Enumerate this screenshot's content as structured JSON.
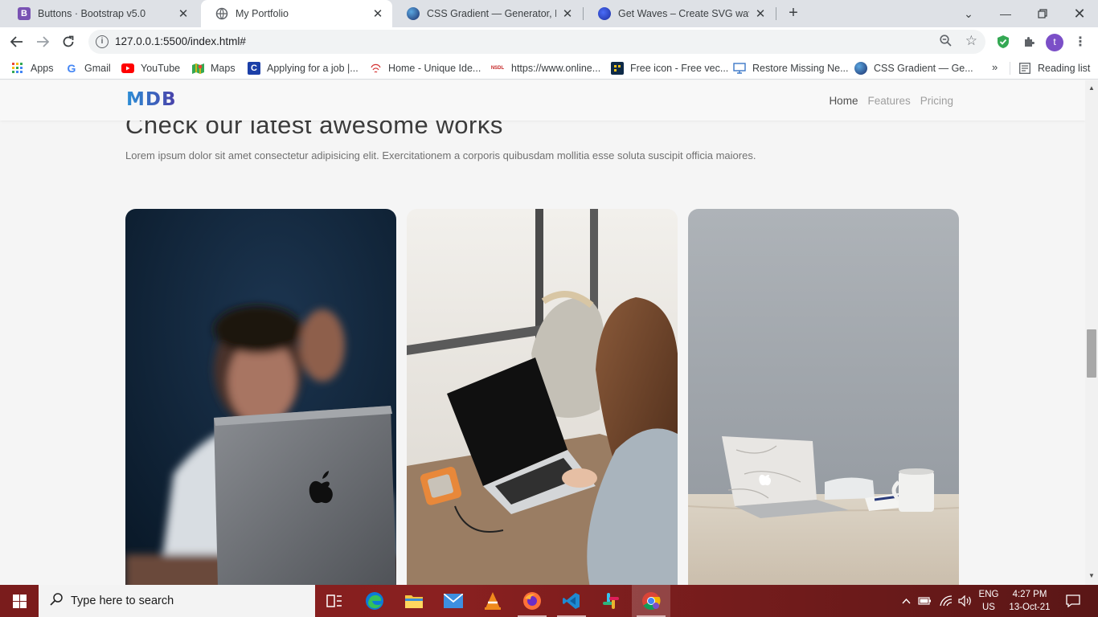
{
  "browser": {
    "tabs": [
      {
        "title": "Buttons · Bootstrap v5.0",
        "active": false
      },
      {
        "title": "My Portfolio",
        "active": true
      },
      {
        "title": "CSS Gradient — Generator, Maker",
        "active": false
      },
      {
        "title": "Get Waves – Create SVG waves for",
        "active": false
      }
    ],
    "url": "127.0.0.1:5500/index.html#",
    "profile_initial": "t",
    "bookmarks": [
      {
        "label": "Apps",
        "icon": "apps-grid-icon"
      },
      {
        "label": "Gmail",
        "icon": "google-icon"
      },
      {
        "label": "YouTube",
        "icon": "youtube-icon"
      },
      {
        "label": "Maps",
        "icon": "maps-icon"
      },
      {
        "label": "Applying for a job |...",
        "icon": "c-icon"
      },
      {
        "label": "Home - Unique Ide...",
        "icon": "fingerprint-icon"
      },
      {
        "label": "https://www.online...",
        "icon": "nsdl-icon"
      },
      {
        "label": "Free icon - Free vec...",
        "icon": "freepik-icon"
      },
      {
        "label": "Restore Missing Ne...",
        "icon": "monitor-icon"
      },
      {
        "label": "CSS Gradient — Ge...",
        "icon": "css-gradient-icon"
      }
    ],
    "bookmarks_overflow": "»",
    "reading_list": "Reading list"
  },
  "site": {
    "logo": "MDB",
    "nav": [
      {
        "label": "Home",
        "current": true
      },
      {
        "label": "Features",
        "current": false
      },
      {
        "label": "Pricing",
        "current": false
      }
    ],
    "heading": "Check our latest awesome works",
    "lead": "Lorem ipsum dolor sit amet consectetur adipisicing elit. Exercitationem a corporis quibusdam mollitia esse soluta suscipit officia maiores.",
    "cards": [
      {
        "image": "man-with-laptop-photo"
      },
      {
        "image": "woman-typing-laptop-photo"
      },
      {
        "image": "marble-laptop-desk-photo"
      }
    ]
  },
  "taskbar": {
    "search_placeholder": "Type here to search",
    "apps": [
      "task-view-icon",
      "edge-icon",
      "file-explorer-icon",
      "mail-icon",
      "vlc-icon",
      "firefox-icon",
      "vscode-icon",
      "slack-icon",
      "chrome-icon"
    ],
    "lang_top": "ENG",
    "lang_bottom": "US",
    "time": "4:27 PM",
    "date": "13-Oct-21"
  },
  "colors": {
    "accent_purple": "#7b4fc7",
    "taskbar": "#8a2020",
    "logo_start": "#2c8fd6",
    "logo_end": "#4a3fa8"
  }
}
